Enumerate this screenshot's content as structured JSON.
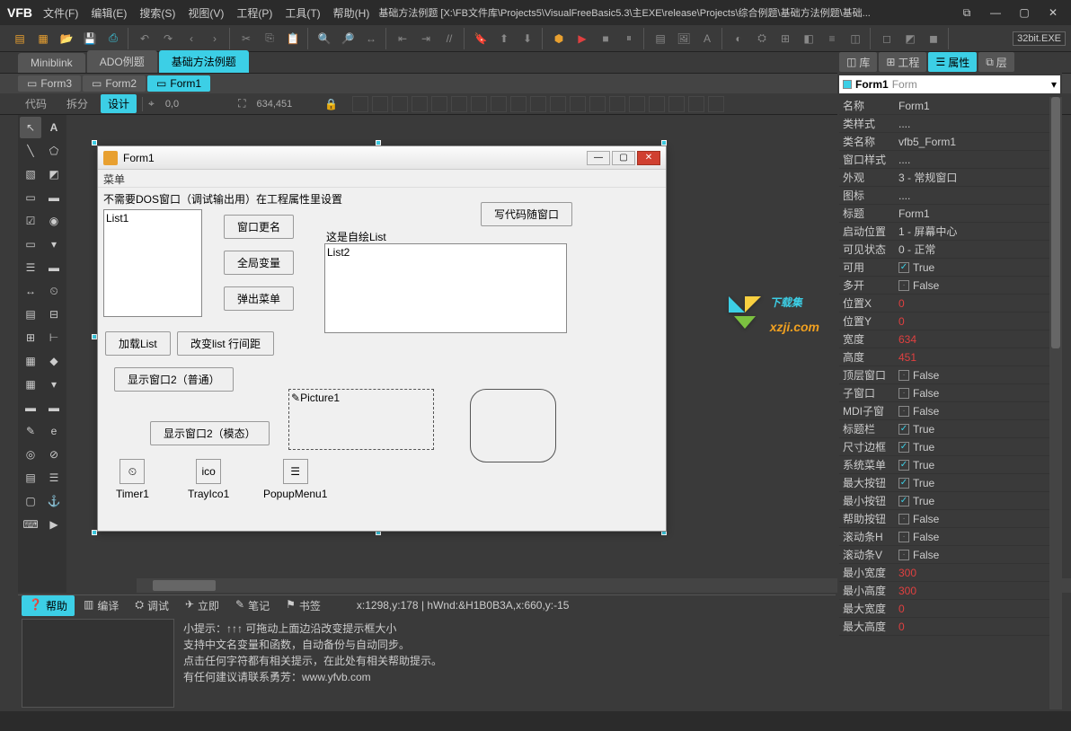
{
  "app": {
    "logo": "VFB"
  },
  "menu": [
    "文件(F)",
    "编辑(E)",
    "搜索(S)",
    "视图(V)",
    "工程(P)",
    "工具(T)",
    "帮助(H)"
  ],
  "title_path": "基础方法例题 [X:\\FB文件库\\Projects5\\VisualFreeBasic5.3\\主EXE\\release\\Projects\\综合例题\\基础方法例题\\基础...",
  "run_target": "32bit.EXE",
  "doc_tabs": [
    "Miniblink",
    "ADO例题",
    "基础方法例题"
  ],
  "doc_tab_active": 2,
  "form_tabs": [
    "Form3",
    "Form2",
    "Form1"
  ],
  "form_tab_active": 2,
  "view_modes": {
    "code": "代码",
    "split": "拆分",
    "design": "设计"
  },
  "coords": {
    "origin": "0,0",
    "size": "634,451"
  },
  "designer": {
    "title": "Form1",
    "menu": "菜单",
    "info_label": "不需要DOS窗口（调试输出用）在工程属性里设置",
    "list1": "List1",
    "list2_header": "这是自绘List",
    "list2": "List2",
    "btns": {
      "write_code": "写代码随窗口",
      "rename": "窗口更名",
      "global_var": "全局变量",
      "popup_menu": "弹出菜单",
      "load_list": "加载List",
      "change_spacing": "改变list 行间距",
      "show_win2_normal": "显示窗口2（普通）",
      "show_win2_modal": "显示窗口2（模态）"
    },
    "picture1": "Picture1",
    "components": {
      "timer": "Timer1",
      "tray": "TrayIco1",
      "popup": "PopupMenu1"
    }
  },
  "panel_tabs": {
    "lib": "库",
    "project": "工程",
    "prop": "属性",
    "layer": "层"
  },
  "prop_header": {
    "type_icon": "□",
    "name": "Form1",
    "type": "Form"
  },
  "properties": [
    {
      "name": "名称",
      "val": "Form1"
    },
    {
      "name": "类样式",
      "val": "...."
    },
    {
      "name": "类名称",
      "val": "vfb5_Form1"
    },
    {
      "name": "窗口样式",
      "val": "...."
    },
    {
      "name": "外观",
      "val": "3 - 常规窗口"
    },
    {
      "name": "图标",
      "val": "...."
    },
    {
      "name": "标题",
      "val": "Form1"
    },
    {
      "name": "启动位置",
      "val": "1 - 屏幕中心"
    },
    {
      "name": "可见状态",
      "val": "0 - 正常"
    },
    {
      "name": "可用",
      "val": "True",
      "chk": true
    },
    {
      "name": "多开",
      "val": "False",
      "chk": false
    },
    {
      "name": "位置X",
      "val": "0",
      "red": true
    },
    {
      "name": "位置Y",
      "val": "0",
      "red": true
    },
    {
      "name": "宽度",
      "val": "634",
      "red": true
    },
    {
      "name": "高度",
      "val": "451",
      "red": true
    },
    {
      "name": "顶层窗口",
      "val": "False",
      "chk": false
    },
    {
      "name": "子窗口",
      "val": "False",
      "chk": false
    },
    {
      "name": "MDI子窗",
      "val": "False",
      "chk": false
    },
    {
      "name": "标题栏",
      "val": "True",
      "chk": true
    },
    {
      "name": "尺寸边框",
      "val": "True",
      "chk": true
    },
    {
      "name": "系统菜单",
      "val": "True",
      "chk": true
    },
    {
      "name": "最大按钮",
      "val": "True",
      "chk": true
    },
    {
      "name": "最小按钮",
      "val": "True",
      "chk": true
    },
    {
      "name": "帮助按钮",
      "val": "False",
      "chk": false
    },
    {
      "name": "滚动条H",
      "val": "False",
      "chk": false
    },
    {
      "name": "滚动条V",
      "val": "False",
      "chk": false
    },
    {
      "name": "最小宽度",
      "val": "300",
      "red": true
    },
    {
      "name": "最小高度",
      "val": "300",
      "red": true
    },
    {
      "name": "最大宽度",
      "val": "0",
      "red": true
    },
    {
      "name": "最大高度",
      "val": "0",
      "red": true
    }
  ],
  "bottom_tabs": [
    "帮助",
    "编译",
    "调试",
    "立即",
    "笔记",
    "书签"
  ],
  "bottom_tab_active": 0,
  "bottom_status": "x:1298,y:178 | hWnd:&H1B0B3A,x:660,y:-15",
  "help_lines": [
    "小提示：↑↑↑ 可拖动上面边沿改变提示框大小",
    "支持中文名变量和函数，自动备份与自动同步。",
    "点击任何字符都有相关提示，在此处有相关帮助提示。",
    "有任何建议请联系勇芳：www.yfvb.com"
  ],
  "watermark": {
    "site": "下载集",
    "url": "xzji.com"
  }
}
